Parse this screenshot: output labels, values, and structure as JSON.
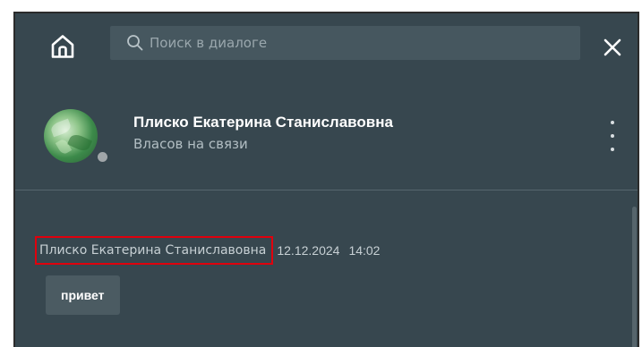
{
  "header": {
    "home_icon": "home-icon",
    "search": {
      "placeholder": "Поиск в диалоге",
      "value": "",
      "icon": "search-icon"
    },
    "close_icon": "close-icon"
  },
  "contact": {
    "name": "Плиско Екатерина Станиславовна",
    "status": "Власов на связи",
    "presence_color": "#a0a6a9",
    "more_icon": "more-vertical-icon"
  },
  "messages": [
    {
      "sender": "Плиско Екатерина Станиславовна",
      "date": "12.12.2024",
      "time": "14:02",
      "text": "привет"
    }
  ],
  "colors": {
    "background": "#37474f",
    "search_bg": "#46575f",
    "bubble_bg": "#4b5b62",
    "highlight": "#e0000d"
  }
}
